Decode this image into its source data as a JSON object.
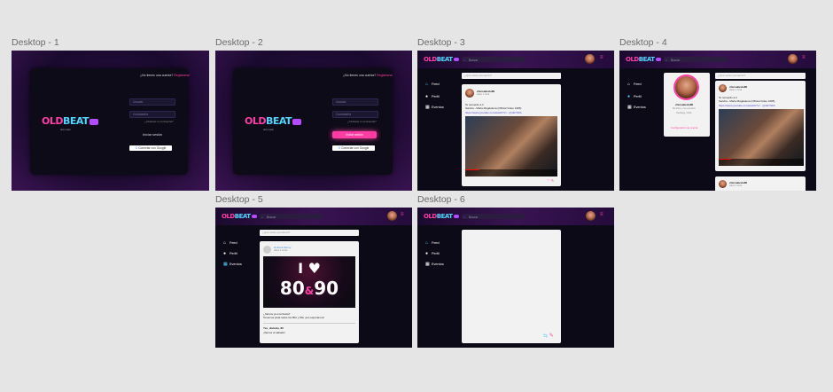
{
  "frames": {
    "d1": "Desktop - 1",
    "d2": "Desktop - 2",
    "d3": "Desktop - 3",
    "d4": "Desktop - 4",
    "d5": "Desktop - 5",
    "d6": "Desktop - 6"
  },
  "brand": {
    "old": "OLD",
    "beat": "BEAT",
    "tagline": "old music"
  },
  "login": {
    "signup_prompt": "¿No tienes una cuenta?",
    "signup_link": "Registrarse",
    "username_placeholder": "Usuario",
    "password_placeholder": "Contraseña",
    "forgot": "¿Olvidaste tu contraseña?",
    "login_button": "Iniciar sesión",
    "google_button": "Conectar con Google"
  },
  "app": {
    "search_placeholder": "Buscar",
    "menu_icon": "≡",
    "new_post_placeholder": "¿Qué estás pensando?",
    "nav": [
      {
        "label": "Feed",
        "icon": "⌂"
      },
      {
        "label": "Perfil",
        "icon": "●"
      },
      {
        "label": "Eventos",
        "icon": "▦"
      }
    ]
  },
  "post": {
    "user": "chicoabrelu80",
    "time": "Hace 1 hora",
    "line1": "Te recuerdo a ti",
    "line2": "Sandra - Maria Magdalena (Official Video 1985)",
    "link": "https://www.youtube.com/watch?v=...Qn3IYSKh"
  },
  "profile": {
    "name": "chicoabrelu80",
    "bio": "80 años y me encanta",
    "location": "Santiago, Chile",
    "settings": "Configuración de cuenta"
  },
  "event": {
    "user": "Dj.Erick.Monty",
    "time": "Hace 2 horas",
    "poster_love": "I ♥",
    "poster_a": "80",
    "poster_amp": "&",
    "poster_b": "90",
    "caption1": "¿Vamos ya a la fiesta?",
    "caption2": "Tenemos pista todos los 80s y 90s ¡Los esperamos!",
    "comment_user": "Yes_dislexia_80",
    "comment_text": "¡Vamos el sábado!"
  }
}
